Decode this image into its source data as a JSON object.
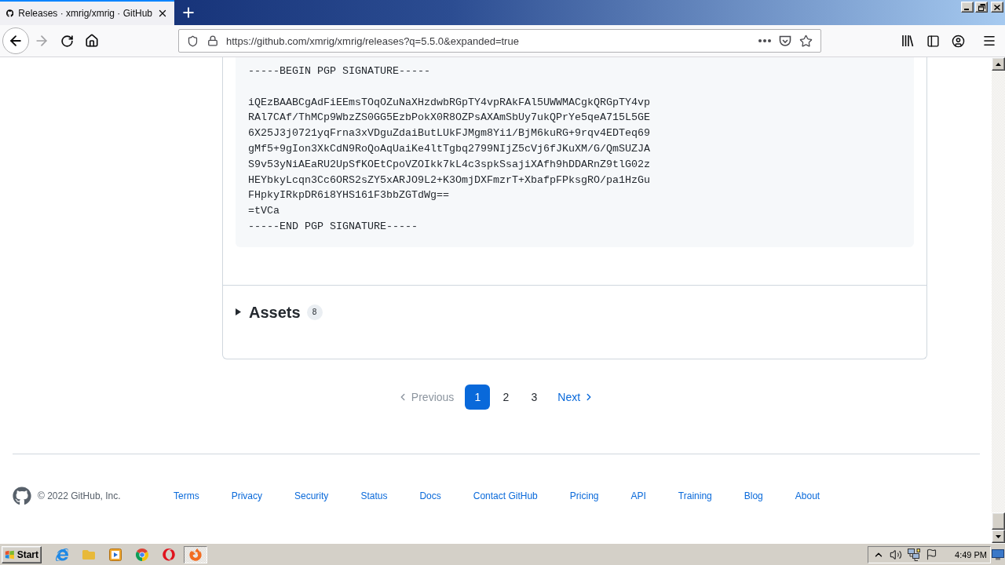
{
  "browser": {
    "tab": {
      "title": "Releases · xmrig/xmrig · GitHub",
      "selected": true
    },
    "toolbar": {
      "back_disabled": false,
      "forward_disabled": true
    },
    "address_bar": {
      "url": "https://github.com/xmrig/xmrig/releases?q=5.5.0&expanded=true"
    }
  },
  "release": {
    "signature": "-----BEGIN PGP SIGNATURE-----\n\niQEzBAABCgAdFiEEmsTOqOZuNaXHzdwbRGpTY4vpRAkFAl5UWWMACgkQRGpTY4vp\nRAl7CAf/ThMCp9WbzZS0GG5EzbPokX0R8OZPsAXAmSbUy7ukQPrYe5qeA715L5GE\n6X25J3j0721yqFrna3xVDguZdaiButLUkFJMgm8Yi1/BjM6kuRG+9rqv4EDTeq69\ngMf5+9gIon3XkCdN9RoQoAqUaiKe4ltTgbq2799NIjZ5cVj6fJKuXM/G/QmSUZJA\nS9v53yNiAEaRU2UpSfKOEtCpoVZOIkk7kL4c3spkSsajiXAfh9hDDARnZ9tlG02z\nHEYbkyLcqn3Cc6ORS2sZY5xARJO9L2+K3OmjDXFmzrT+XbafpFPksgRO/pa1HzGu\nFHpkyIRkpDR6i8YHS161F3bbZGTdWg==\n=tVCa\n-----END PGP SIGNATURE-----",
    "assets": {
      "label": "Assets",
      "count": "8",
      "expanded": false
    }
  },
  "pagination": {
    "previous": {
      "label": "Previous",
      "disabled": true
    },
    "pages": [
      {
        "label": "1",
        "selected": true
      },
      {
        "label": "2",
        "selected": false
      },
      {
        "label": "3",
        "selected": false
      }
    ],
    "next": {
      "label": "Next",
      "disabled": false
    }
  },
  "footer": {
    "copyright": "© 2022 GitHub, Inc.",
    "links": [
      "Terms",
      "Privacy",
      "Security",
      "Status",
      "Docs",
      "Contact GitHub",
      "Pricing",
      "API",
      "Training",
      "Blog",
      "About"
    ]
  },
  "taskbar": {
    "start": "Start",
    "apps": [
      {
        "kind": "ie",
        "selected": false
      },
      {
        "kind": "folder",
        "selected": false
      },
      {
        "kind": "media",
        "selected": false
      },
      {
        "kind": "chrome",
        "selected": false
      },
      {
        "kind": "opera",
        "selected": false
      },
      {
        "kind": "firefox",
        "selected": true
      }
    ],
    "clock": "4:49 PM"
  }
}
